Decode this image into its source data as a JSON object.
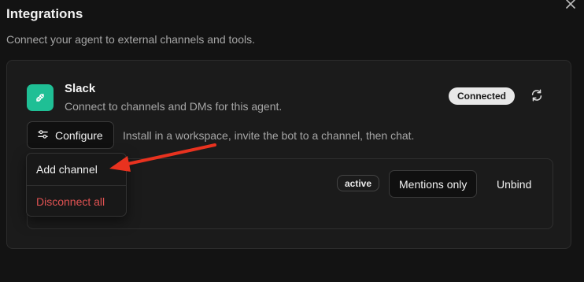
{
  "header": {
    "title": "Integrations",
    "subtitle": "Connect your agent to external channels and tools.",
    "close_icon": "close-icon"
  },
  "integration": {
    "name": "Slack",
    "description": "Connect to channels and DMs for this agent.",
    "icon": "plug-icon",
    "icon_color": "#1fbf95",
    "status": "Connected",
    "refresh_icon": "refresh-icon",
    "configure_label": "Configure",
    "configure_icon": "sliders-icon",
    "install_hint": "Install in a workspace, invite the bot to a channel, then chat."
  },
  "channel": {
    "status_badge": "active",
    "mode_label": "Mentions only",
    "unbind_label": "Unbind"
  },
  "dropdown": {
    "items": [
      {
        "label": "Add channel",
        "style": "normal"
      },
      {
        "label": "Disconnect all",
        "style": "danger",
        "color": "#e05252"
      }
    ]
  },
  "annotation": {
    "arrow_color": "#e8321f"
  }
}
